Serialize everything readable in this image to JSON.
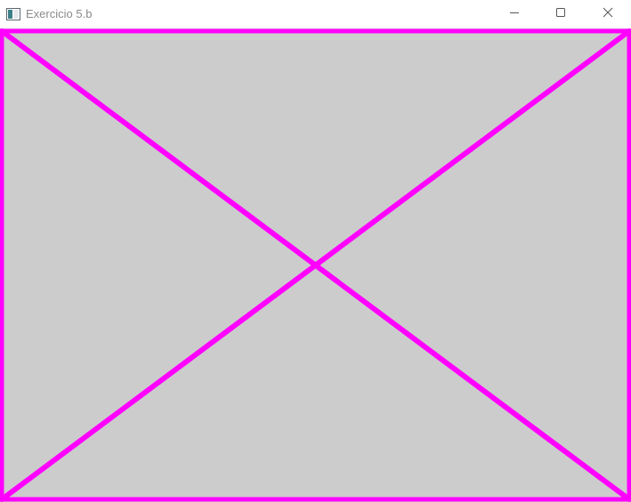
{
  "window": {
    "title": "Exercicio 5.b",
    "controls": {
      "minimize_icon": "minimize-icon",
      "maximize_icon": "maximize-icon",
      "close_icon": "close-icon"
    }
  },
  "canvas": {
    "background_color": "#cccccc",
    "line_color": "#ff00ff",
    "shapes": [
      "border-rectangle",
      "diagonal-top-left-to-bottom-right",
      "diagonal-top-right-to-bottom-left"
    ]
  }
}
